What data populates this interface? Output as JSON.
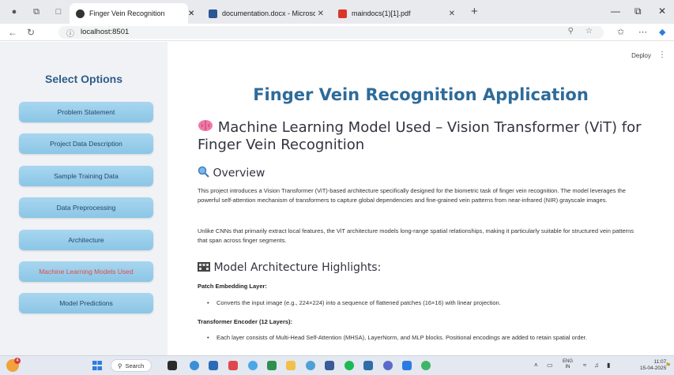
{
  "browser": {
    "tabs": [
      {
        "label": "Finger Vein Recognition",
        "active": true,
        "favicon_color": "#333333"
      },
      {
        "label": "documentation.docx - Microsoft",
        "active": false,
        "favicon_color": "#2b5797"
      },
      {
        "label": "maindocs(1)[1].pdf",
        "active": false,
        "favicon_color": "#d9362b"
      }
    ],
    "url": "localhost:8501"
  },
  "sidebar": {
    "title": "Select Options",
    "items": [
      {
        "label": "Problem Statement"
      },
      {
        "label": "Project Data Description"
      },
      {
        "label": "Sample Training Data"
      },
      {
        "label": "Data Preprocessing"
      },
      {
        "label": "Architecture"
      },
      {
        "label": "Machine Learning Models Used",
        "active": true
      },
      {
        "label": "Model Predictions"
      }
    ]
  },
  "header": {
    "deploy_label": "Deploy",
    "menu_glyph": "⋮"
  },
  "main": {
    "app_title": "Finger Vein Recognition Application",
    "section_title": "Machine Learning Model Used – Vision Transformer (ViT) for Finger Vein Recognition",
    "overview_heading": "Overview",
    "overview_p1": "This project introduces a Vision Transformer (ViT)-based architecture specifically designed for the biometric task of finger vein recognition. The model leverages the powerful self-attention mechanism of transformers to capture global dependencies and fine-grained vein patterns from near-infrared (NIR) grayscale images.",
    "overview_p2": "Unlike CNNs that primarily extract local features, the ViT architecture models long-range spatial relationships, making it particularly suitable for structured vein patterns that span across finger segments.",
    "arch_heading": "Model Architecture Highlights:",
    "patch_heading": "Patch Embedding Layer:",
    "patch_bullet": "Converts the input image (e.g., 224×224) into a sequence of flattened patches (16×16) with linear projection.",
    "encoder_heading": "Transformer Encoder (12 Layers):",
    "encoder_bullet": "Each layer consists of Multi-Head Self-Attention (MHSA), LayerNorm, and MLP blocks. Positional encodings are added to retain spatial order."
  },
  "taskbar": {
    "search_label": "Search",
    "weather_badge": "4",
    "lang_line1": "ENG",
    "lang_line2": "IN",
    "time": "11:07",
    "date": "15-04-2025"
  },
  "colors": {
    "accent": "#2e6b99",
    "sidebar_bg": "#f0f2f6",
    "button_bg": "#a8d6ef",
    "active_label": "#e24b4b"
  }
}
